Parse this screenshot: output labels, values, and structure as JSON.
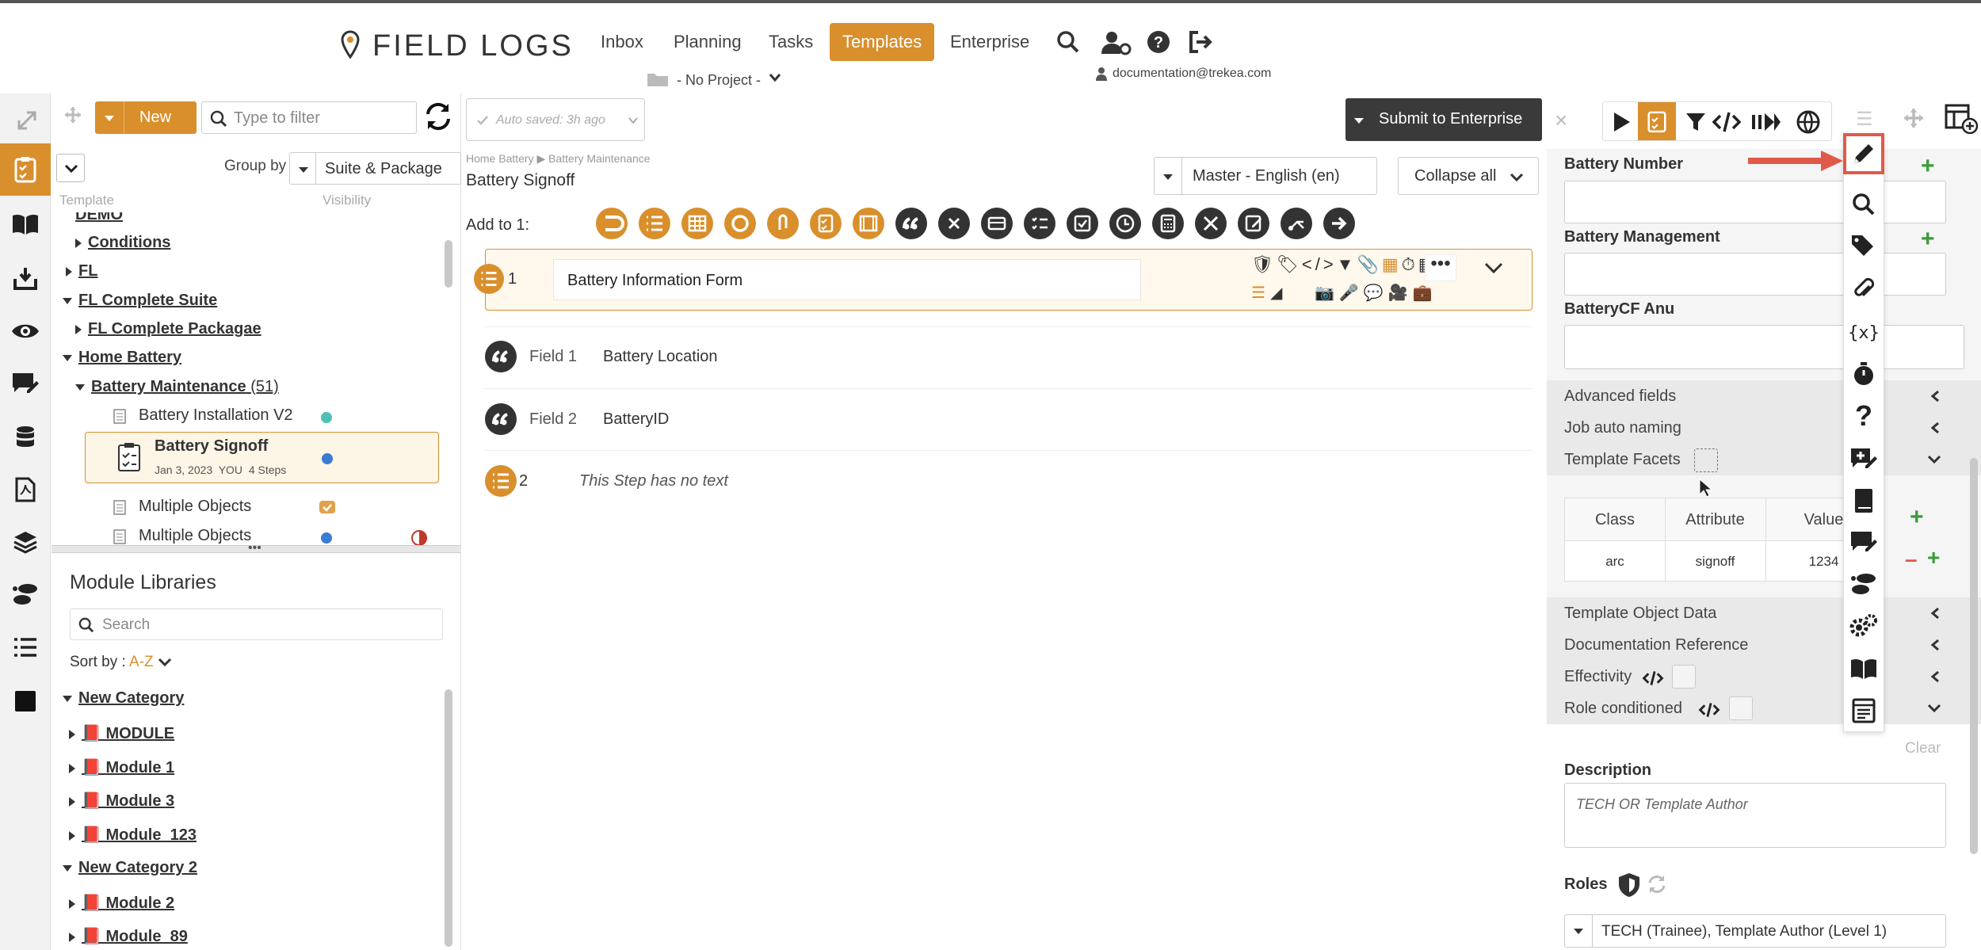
{
  "app": {
    "logo": "FIELD LOGS"
  },
  "nav": {
    "items": [
      "Inbox",
      "Planning",
      "Tasks",
      "Templates",
      "Enterprise"
    ],
    "project": "- No Project -",
    "user": "documentation@trekea.com"
  },
  "left": {
    "new_label": "New",
    "filter_placeholder": "Type to filter",
    "group_by_label": "Group by",
    "group_by_value": "Suite & Package",
    "col_template": "Template",
    "col_visibility": "Visibility",
    "tree": {
      "demo": "DEMO",
      "conditions": "Conditions",
      "fl": "FL",
      "fl_complete_suite": "FL Complete Suite",
      "fl_complete_package": "FL Complete Packagae",
      "home_battery": "Home Battery",
      "battery_maintenance": "Battery Maintenance",
      "battery_maintenance_count": "(51)",
      "battery_install": "Battery Installation V2",
      "battery_signoff": "Battery Signoff",
      "battery_signoff_meta": "Jan 3, 2023  YOU  4 Steps",
      "multiple_objects_1": "Multiple Objects",
      "multiple_objects_2": "Multiple Objects"
    },
    "modules": {
      "title": "Module Libraries",
      "search_placeholder": "Search",
      "sort_label": "Sort by :",
      "sort_value": "A-Z",
      "items": [
        "New Category",
        "MODULE",
        "Module 1",
        "Module 3",
        "Module_123",
        "New Category 2",
        "Module 2",
        "Module_89"
      ]
    }
  },
  "center": {
    "autosave": "Auto saved: 3h ago",
    "submit": "Submit to Enterprise",
    "breadcrumb_1": "Home Battery",
    "breadcrumb_2": "Battery Maintenance",
    "title": "Battery Signoff",
    "language": "Master - English (en)",
    "collapse": "Collapse all",
    "add_to": "Add to 1:",
    "step1_num": "1",
    "step1_title": "Battery Information Form",
    "field1_label": "Field 1",
    "field1_value": "Battery Location",
    "field2_label": "Field 2",
    "field2_value": "BatteryID",
    "step2_num": "2",
    "step2_text": "This Step has no text"
  },
  "right": {
    "battery_number": "Battery Number",
    "battery_management": "Battery Management",
    "batterycf": "BatteryCF Anu",
    "advanced": "Advanced fields",
    "job_naming": "Job auto naming",
    "facets": "Template Facets",
    "facets_table": {
      "headers": [
        "Class",
        "Attribute",
        "Value"
      ],
      "row": [
        "arc",
        "signoff",
        "1234"
      ]
    },
    "object_data": "Template Object Data",
    "doc_ref": "Documentation Reference",
    "effectivity": "Effectivity",
    "role_conditioned": "Role conditioned",
    "clear": "Clear",
    "description_label": "Description",
    "description_value": "TECH OR Template Author",
    "roles_label": "Roles",
    "roles_value": "TECH (Trainee), Template Author (Level 1)"
  },
  "colors": {
    "accent": "#d98f2c",
    "dark": "#333333",
    "highlight": "#e05a4a"
  }
}
